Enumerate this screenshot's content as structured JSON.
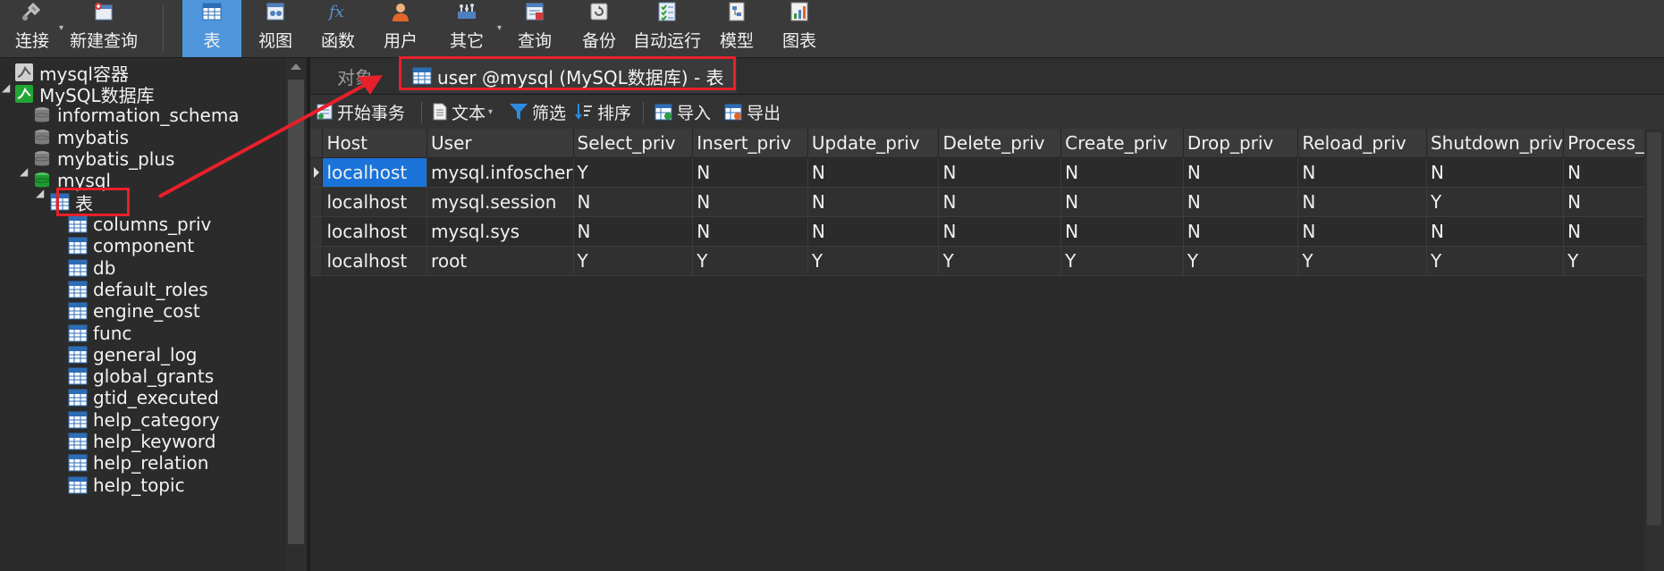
{
  "toolbar": {
    "items": [
      {
        "label": "连接",
        "icon": "connect-icon"
      },
      {
        "label": "新建查询",
        "icon": "new-query-icon"
      },
      {
        "label": "表",
        "icon": "table-icon",
        "active": true
      },
      {
        "label": "视图",
        "icon": "view-icon"
      },
      {
        "label": "函数",
        "icon": "function-icon"
      },
      {
        "label": "用户",
        "icon": "user-icon"
      },
      {
        "label": "其它",
        "icon": "other-icon"
      },
      {
        "label": "查询",
        "icon": "query-icon"
      },
      {
        "label": "备份",
        "icon": "backup-icon"
      },
      {
        "label": "自动运行",
        "icon": "automation-icon"
      },
      {
        "label": "模型",
        "icon": "model-icon"
      },
      {
        "label": "图表",
        "icon": "chart-icon"
      }
    ],
    "accent": "#4f96dc"
  },
  "tree": {
    "connections": [
      {
        "label": "mysql容器"
      },
      {
        "label": "MySQL数据库"
      }
    ],
    "databases": [
      {
        "label": "information_schema"
      },
      {
        "label": "mybatis"
      },
      {
        "label": "mybatis_plus"
      },
      {
        "label": "mysql"
      }
    ],
    "tables_node": "表",
    "tables": [
      "columns_priv",
      "component",
      "db",
      "default_roles",
      "engine_cost",
      "func",
      "general_log",
      "global_grants",
      "gtid_executed",
      "help_category",
      "help_keyword",
      "help_relation",
      "help_topic"
    ]
  },
  "tabs": {
    "objects": "对象",
    "active": "user @mysql (MySQL数据库) - 表"
  },
  "subtoolbar": {
    "begin_transaction": "开始事务",
    "text": "文本",
    "filter": "筛选",
    "sort": "排序",
    "import": "导入",
    "export": "导出"
  },
  "grid": {
    "columns": [
      "Host",
      "User",
      "Select_priv",
      "Insert_priv",
      "Update_priv",
      "Delete_priv",
      "Create_priv",
      "Drop_priv",
      "Reload_priv",
      "Shutdown_priv",
      "Process_pr"
    ],
    "rows": [
      [
        "localhost",
        "mysql.infoscher",
        "Y",
        "N",
        "N",
        "N",
        "N",
        "N",
        "N",
        "N",
        "N"
      ],
      [
        "localhost",
        "mysql.session",
        "N",
        "N",
        "N",
        "N",
        "N",
        "N",
        "N",
        "Y",
        "N"
      ],
      [
        "localhost",
        "mysql.sys",
        "N",
        "N",
        "N",
        "N",
        "N",
        "N",
        "N",
        "N",
        "N"
      ],
      [
        "localhost",
        "root",
        "Y",
        "Y",
        "Y",
        "Y",
        "Y",
        "Y",
        "Y",
        "Y",
        "Y"
      ]
    ],
    "selected_color": "#1a73d9"
  },
  "annotation_color": "#e8202a"
}
